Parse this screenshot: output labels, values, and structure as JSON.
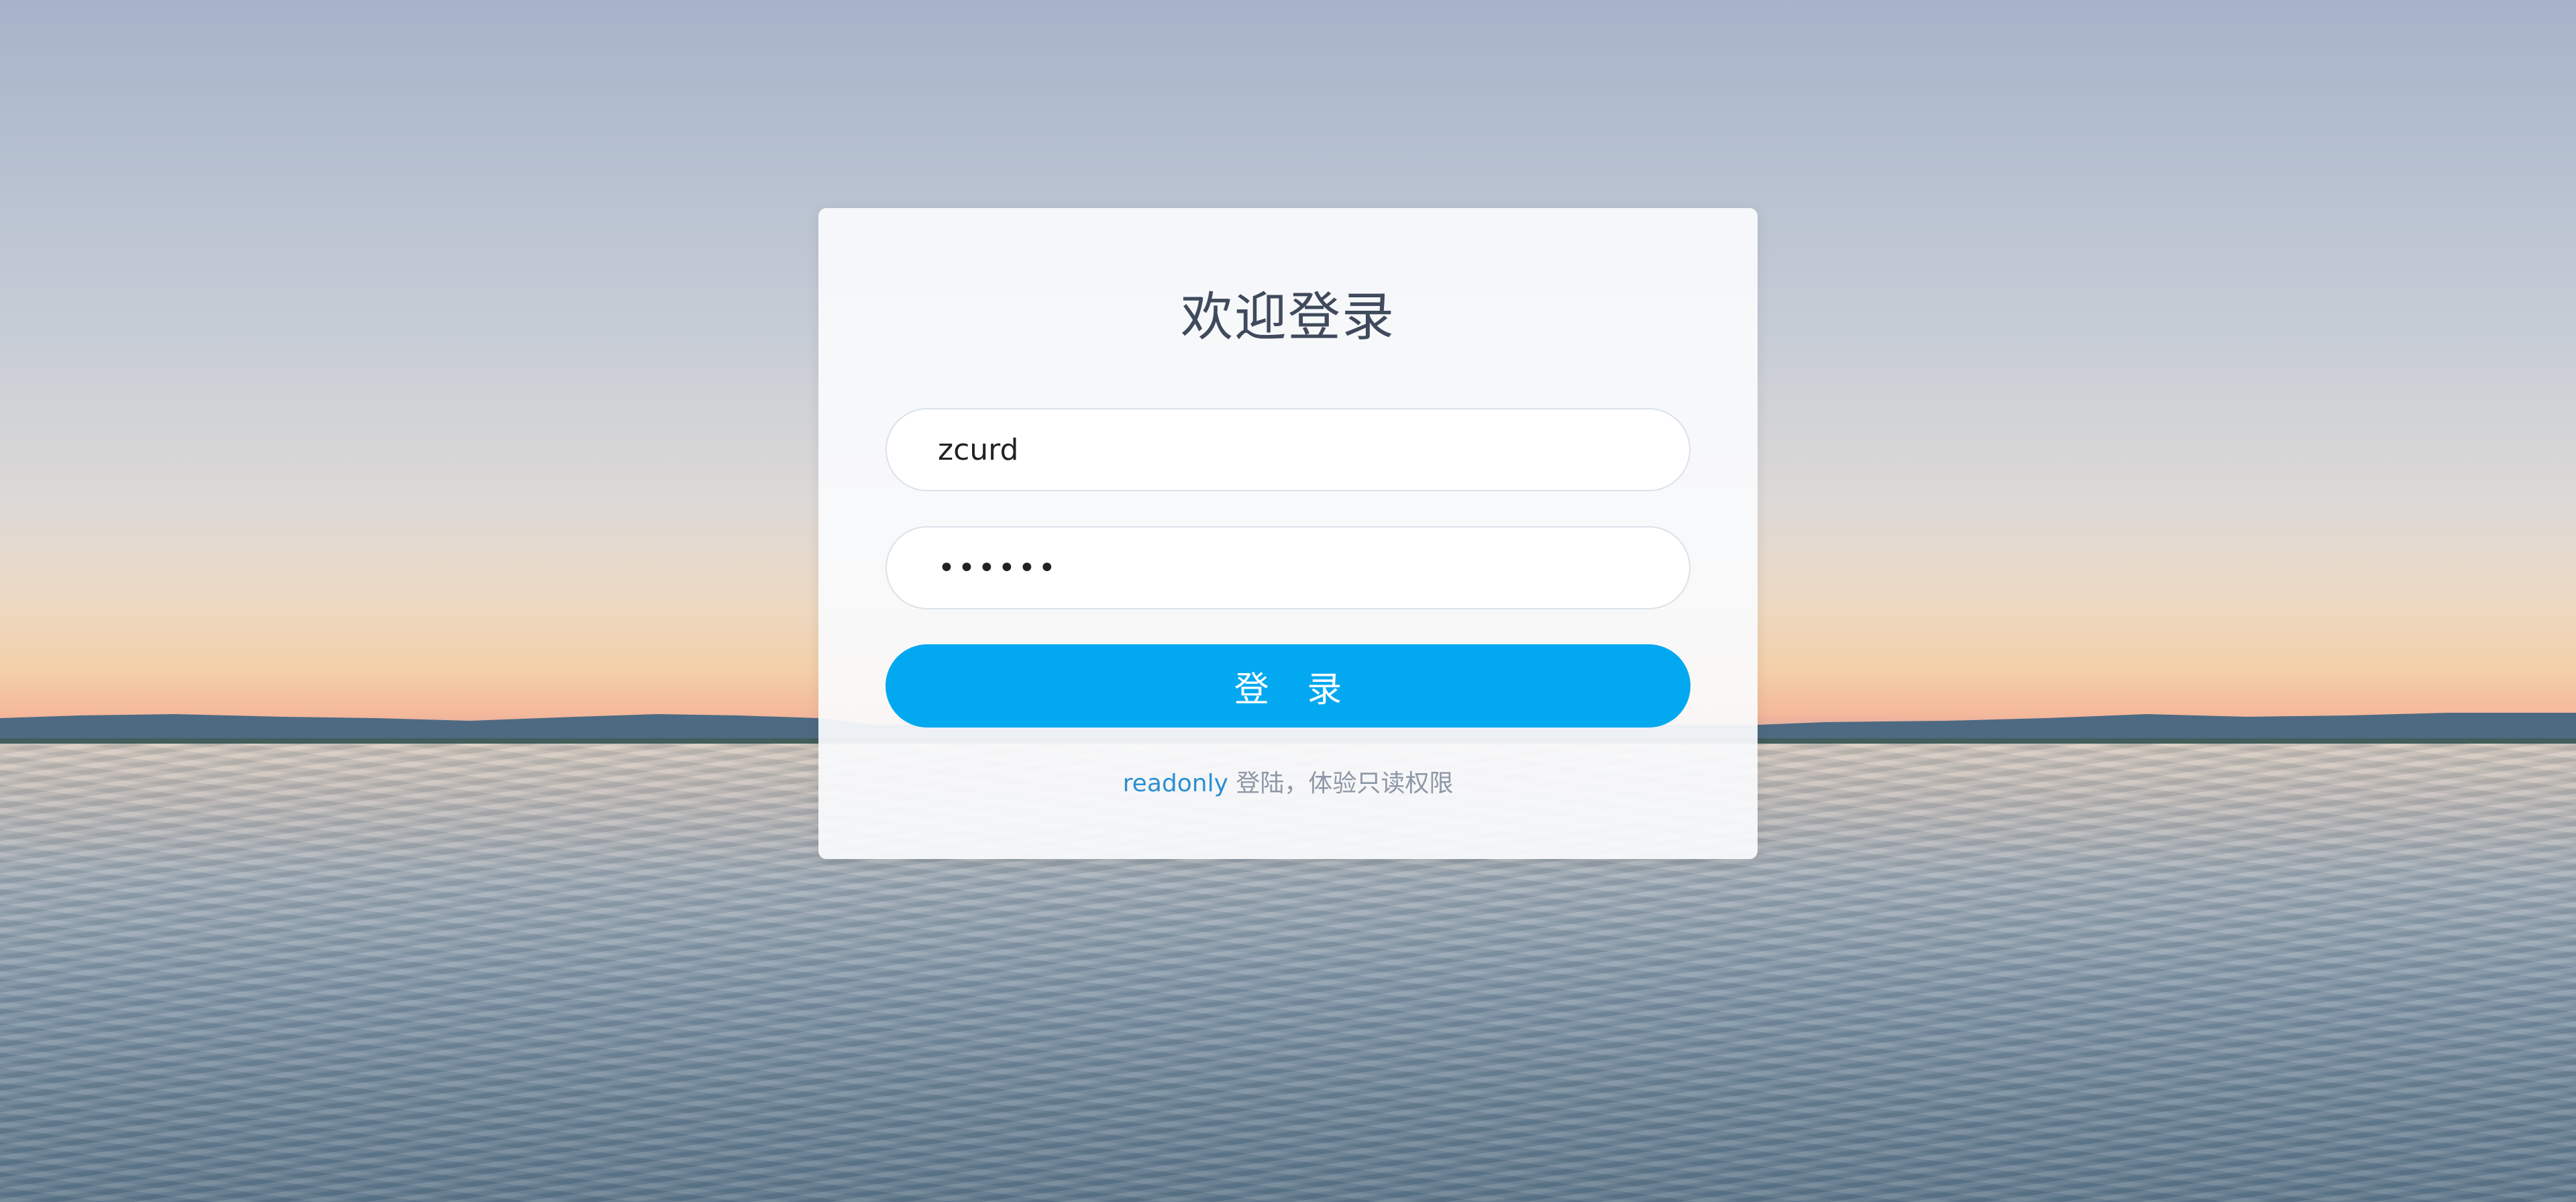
{
  "login": {
    "title": "欢迎登录",
    "username_value": "zcurd",
    "password_value": "••••••",
    "submit_label": "登 录",
    "hint_link": "readonly",
    "hint_text": " 登陆，体验只读权限"
  },
  "colors": {
    "button": "#03a9f0",
    "link": "#2b8fd1",
    "title": "#3f4a5c"
  }
}
